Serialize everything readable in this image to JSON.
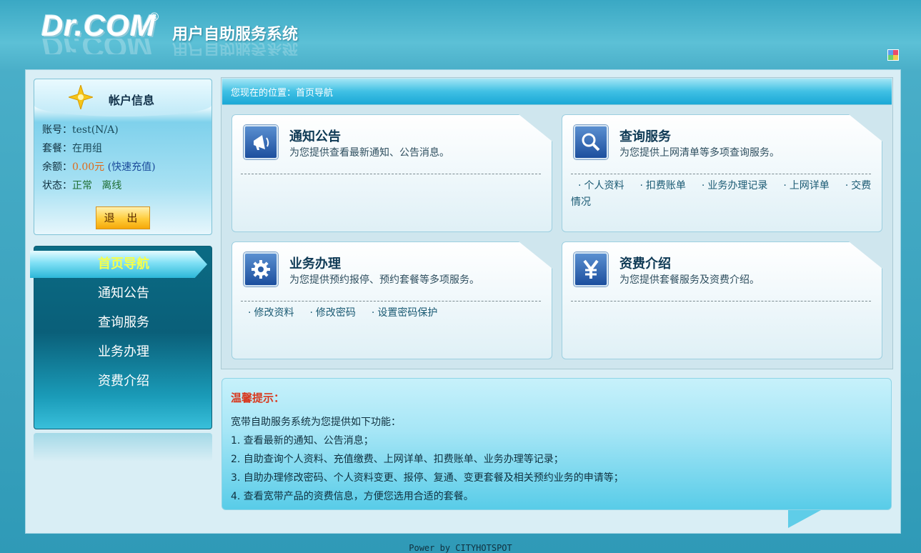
{
  "header": {
    "logo_text": "Dr.COM",
    "logo_mark": "®",
    "system_title": "用户自助服务系统"
  },
  "account": {
    "title": "帐户信息",
    "rows": [
      {
        "label": "账号：",
        "value": "test(N/A)"
      },
      {
        "label": "套餐：",
        "value": "在用组"
      },
      {
        "label": "余额：",
        "value": "0.00元",
        "link": "(快速充值)"
      },
      {
        "label": "状态：",
        "value": "正常",
        "value2": "离线"
      }
    ],
    "logout_label": "退 出"
  },
  "nav": {
    "items": [
      {
        "label": "首页导航",
        "active": true
      },
      {
        "label": "通知公告"
      },
      {
        "label": "查询服务"
      },
      {
        "label": "业务办理"
      },
      {
        "label": "资费介绍"
      }
    ]
  },
  "breadcrumb": "您现在的位置：首页导航",
  "cards": [
    {
      "title": "通知公告",
      "desc": "为您提供查看最新通知、公告消息。",
      "icon": "megaphone-icon",
      "links": []
    },
    {
      "title": "查询服务",
      "desc": "为您提供上网清单等多项查询服务。",
      "icon": "magnifier-icon",
      "links": [
        "个人资料",
        "扣费账单",
        "业务办理记录",
        "上网详单",
        "交费情况"
      ]
    },
    {
      "title": "业务办理",
      "desc": "为您提供预约报停、预约套餐等多项服务。",
      "icon": "gear-icon",
      "links": [
        "修改资料",
        "修改密码",
        "设置密码保护"
      ]
    },
    {
      "title": "资费介绍",
      "desc": "为您提供套餐服务及资费介绍。",
      "icon": "yen-icon",
      "links": []
    }
  ],
  "tips": {
    "title": "温馨提示：",
    "lines": [
      "宽带自助服务系统为您提供如下功能：",
      "1. 查看最新的通知、公告消息；",
      "2. 自助查询个人资料、充值缴费、上网详单、扣费账单、业务办理等记录；",
      "3. 自助办理修改密码、个人资料变更、报停、复通、变更套餐及相关预约业务的申请等；",
      "4. 查看宽带产品的资费信息，方便您选用合适的套餐。"
    ]
  },
  "footer": "Power by CITYHOTSPOT",
  "colors": {
    "accent": "#1aa8d6",
    "nav_active_text": "#f6ff4a",
    "money": "#e06a1a",
    "tips_title": "#d8381e"
  }
}
